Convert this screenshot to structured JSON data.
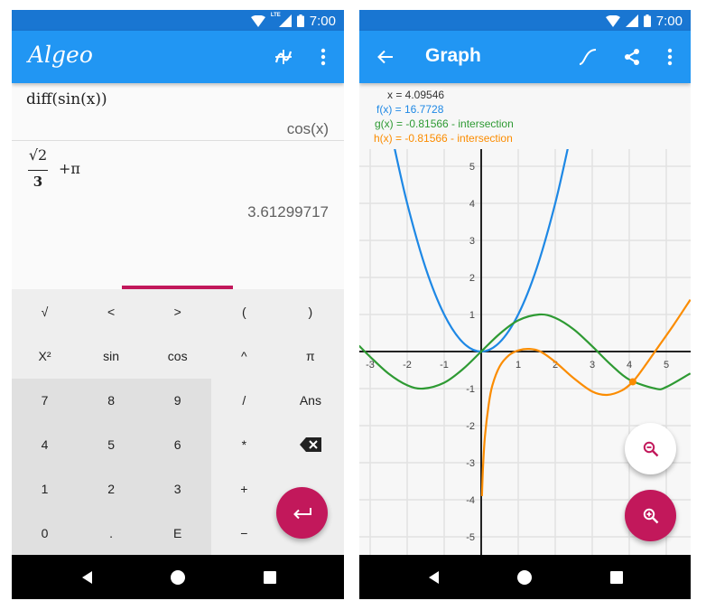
{
  "status_bar": {
    "time": "7:00",
    "network_label": "LTE"
  },
  "calculator": {
    "app_title": "Algeo",
    "entries": [
      {
        "expression": "diff(sin(x))",
        "result": "cos(x)"
      },
      {
        "expression_numerator": "√2",
        "expression_denominator": "3",
        "expression_rest": "+π",
        "result": "3.61299717"
      }
    ],
    "keys": [
      [
        "√",
        "<",
        ">",
        "(",
        ")"
      ],
      [
        "X²",
        "sin",
        "cos",
        "^",
        "π"
      ],
      [
        "7",
        "8",
        "9",
        "/",
        "Ans"
      ],
      [
        "4",
        "5",
        "6",
        "*",
        "backspace"
      ],
      [
        "1",
        "2",
        "3",
        "+",
        ""
      ],
      [
        "0",
        ".",
        "E",
        "−",
        ""
      ]
    ],
    "enter_label": "enter",
    "accent_color": "#c2185b"
  },
  "graph": {
    "title": "Graph",
    "readout": {
      "x": "x = 4.09546",
      "f": "f(x) = 16.7728",
      "g": "g(x) = -0.81566 - intersection",
      "h": "h(x) = -0.81566 - intersection"
    }
  },
  "chart_data": {
    "type": "line",
    "title": "",
    "xlabel": "",
    "ylabel": "",
    "xlim": [
      -3.3,
      5.65
    ],
    "ylim": [
      -5.5,
      5.5
    ],
    "x_ticks": [
      -3,
      -2,
      -1,
      1,
      2,
      3,
      4,
      5
    ],
    "y_ticks": [
      5,
      4,
      3,
      2,
      1,
      -1,
      -2,
      -3,
      -4,
      -5
    ],
    "grid": true,
    "series": [
      {
        "name": "f(x)",
        "color": "#1e88e5",
        "expr": "x^2",
        "points": [
          [
            -2.4,
            5.76
          ],
          [
            -2,
            4
          ],
          [
            -1.5,
            2.25
          ],
          [
            -1,
            1
          ],
          [
            -0.5,
            0.25
          ],
          [
            0,
            0
          ],
          [
            0.5,
            0.25
          ],
          [
            1,
            1
          ],
          [
            1.5,
            2.25
          ],
          [
            2,
            4
          ],
          [
            2.4,
            5.76
          ]
        ]
      },
      {
        "name": "g(x)",
        "color": "#2e9a33",
        "expr": "sin(x)",
        "points": [
          [
            -3.3,
            0.158
          ],
          [
            -3,
            -0.141
          ],
          [
            -2.5,
            -0.598
          ],
          [
            -2,
            -0.909
          ],
          [
            -1.57,
            -1
          ],
          [
            -1,
            -0.841
          ],
          [
            -0.5,
            -0.479
          ],
          [
            0,
            0
          ],
          [
            0.5,
            0.479
          ],
          [
            1,
            0.841
          ],
          [
            1.57,
            1
          ],
          [
            2,
            0.909
          ],
          [
            2.5,
            0.598
          ],
          [
            3,
            0.141
          ],
          [
            3.5,
            -0.351
          ],
          [
            4,
            -0.757
          ],
          [
            4.71,
            -1
          ],
          [
            5,
            -0.959
          ],
          [
            5.65,
            -0.59
          ]
        ]
      },
      {
        "name": "h(x)",
        "color": "#fb8c00",
        "expr": "",
        "points": [
          [
            0.02,
            -3.9
          ],
          [
            0.05,
            -3.1
          ],
          [
            0.1,
            -2.3
          ],
          [
            0.2,
            -1.45
          ],
          [
            0.3,
            -0.92
          ],
          [
            0.5,
            -0.4
          ],
          [
            0.75,
            -0.1
          ],
          [
            1,
            0.03
          ],
          [
            1.3,
            0.07
          ],
          [
            1.6,
            0.0
          ],
          [
            2,
            -0.28
          ],
          [
            2.5,
            -0.72
          ],
          [
            3,
            -1.08
          ],
          [
            3.4,
            -1.17
          ],
          [
            3.8,
            -1.05
          ],
          [
            4.09546,
            -0.81566
          ],
          [
            4.4,
            -0.42
          ],
          [
            4.8,
            0.15
          ],
          [
            5.2,
            0.72
          ],
          [
            5.65,
            1.4
          ]
        ]
      }
    ],
    "highlight_point": {
      "x": 4.09546,
      "y": -0.81566,
      "color": "#fb8c00"
    }
  }
}
